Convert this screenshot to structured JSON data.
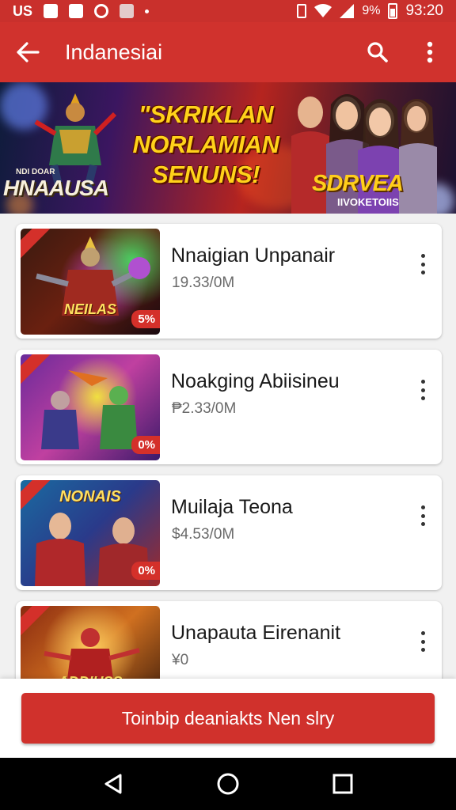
{
  "status": {
    "left_text": "US",
    "battery": "9%",
    "time": "93:20"
  },
  "app_bar": {
    "title": "Indanesiai"
  },
  "banner": {
    "headline_1": "\"SKRIKLAN",
    "headline_2": "NORLAMIAN",
    "headline_3": "SENUNS!",
    "logo_top": "NDI   DOAR",
    "logo": "HNAAUSA",
    "badge": "SDRVEA",
    "badge_sub": "IIVOKETOIIS"
  },
  "items": [
    {
      "title": "Nnaigian Unpanair",
      "price": "19.33/0M",
      "discount": "5%",
      "overlay": "NEILAS"
    },
    {
      "title": "Noakging Abiisineu",
      "price": "₱2.33/0M",
      "discount": "0%",
      "overlay": ""
    },
    {
      "title": "Muilaja Teona",
      "price": "$4.53/0M",
      "discount": "0%",
      "overlay": "NONAIS"
    },
    {
      "title": "Unapauta Eirenanit",
      "price": "¥0",
      "discount": "",
      "overlay": "ADDIUSS"
    }
  ],
  "cta": {
    "label": "Toinbip deaniakts Nen slry"
  },
  "colors": {
    "primary": "#d0322d",
    "status": "#c9302c"
  },
  "icons": [
    "back-arrow-icon",
    "search-icon",
    "more-vert-icon",
    "nav-back-icon",
    "nav-home-icon",
    "nav-recents-icon"
  ]
}
